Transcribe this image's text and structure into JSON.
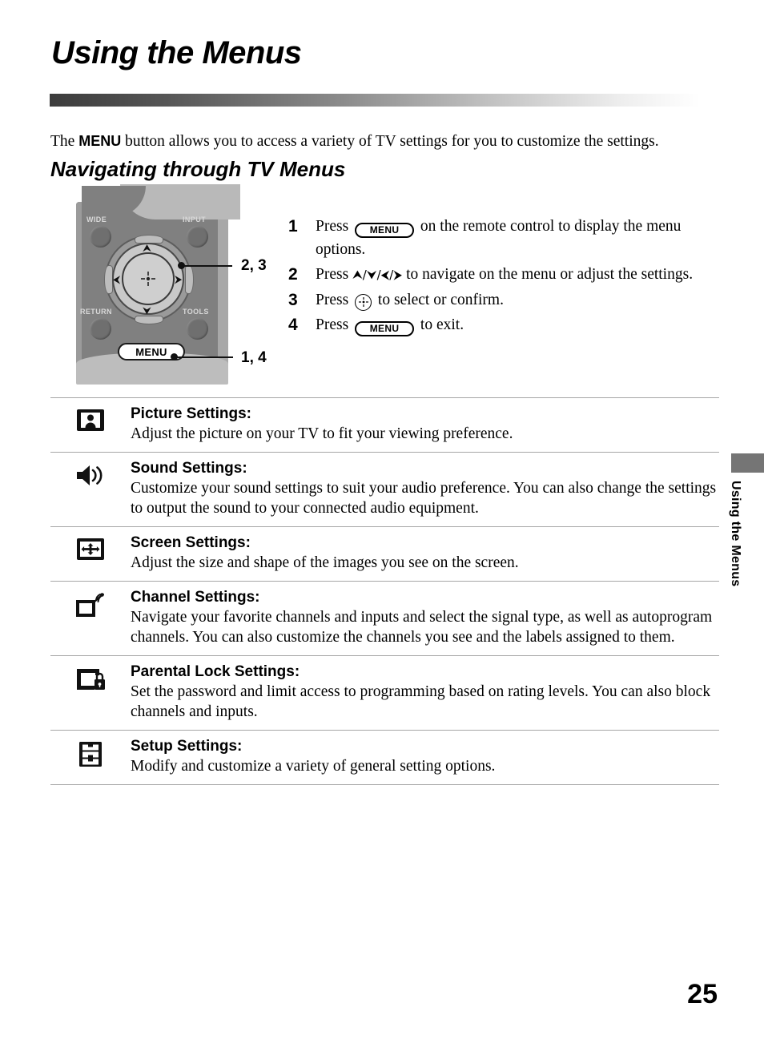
{
  "page": {
    "title": "Using the Menus",
    "number": "25",
    "side_tab_label": "Using the Menus"
  },
  "intro": {
    "before": "The ",
    "bold": "MENU",
    "after": " button allows you to access a variety of TV settings for you to customize the settings."
  },
  "section": {
    "heading": "Navigating through TV Menus"
  },
  "remote": {
    "buttons": {
      "wide": "WIDE",
      "input": "INPUT",
      "return": "RETURN",
      "tools": "TOOLS",
      "menu": "MENU"
    },
    "arrows": {
      "up": "⮝",
      "down": "⮟",
      "left": "⮜",
      "right": "⮞"
    },
    "callouts": {
      "dpad": "2, 3",
      "menu": "1, 4"
    }
  },
  "steps": [
    {
      "num": "1",
      "pre": "Press ",
      "key": "MENU",
      "key_type": "menu",
      "post": " on the remote control to display the menu options."
    },
    {
      "num": "2",
      "pre": "Press ",
      "key": "⮝/⮟/⮜/⮞",
      "key_type": "arrows",
      "post": " to navigate on the menu or adjust the settings."
    },
    {
      "num": "3",
      "pre": "Press ",
      "key": "",
      "key_type": "enter",
      "post": " to select or confirm."
    },
    {
      "num": "4",
      "pre": "Press ",
      "key": "MENU",
      "key_type": "menu",
      "post": " to exit."
    }
  ],
  "settings": [
    {
      "icon": "picture-settings-icon",
      "title": "Picture Settings:",
      "desc": "Adjust the picture on your TV to fit your viewing preference."
    },
    {
      "icon": "sound-settings-icon",
      "title": "Sound Settings:",
      "desc": "Customize your sound settings to suit your audio preference. You can also change the settings to output the sound to your connected audio equipment."
    },
    {
      "icon": "screen-settings-icon",
      "title": "Screen Settings:",
      "desc": "Adjust the size and shape of the images you see on the screen."
    },
    {
      "icon": "channel-settings-icon",
      "title": "Channel Settings:",
      "desc": "Navigate your favorite channels and inputs and select the signal type, as well as autoprogram channels. You can also customize the channels you see and the labels assigned to them."
    },
    {
      "icon": "parental-lock-settings-icon",
      "title": "Parental Lock Settings:",
      "desc": "Set the password and limit access to programming based on rating levels. You can also block channels and inputs."
    },
    {
      "icon": "setup-settings-icon",
      "title": "Setup Settings:",
      "desc": "Modify and customize a variety of general setting options."
    }
  ],
  "colors": {
    "rule_dark": "#3c3c3c",
    "remote_body": "#808080",
    "side_tab": "#757575"
  }
}
